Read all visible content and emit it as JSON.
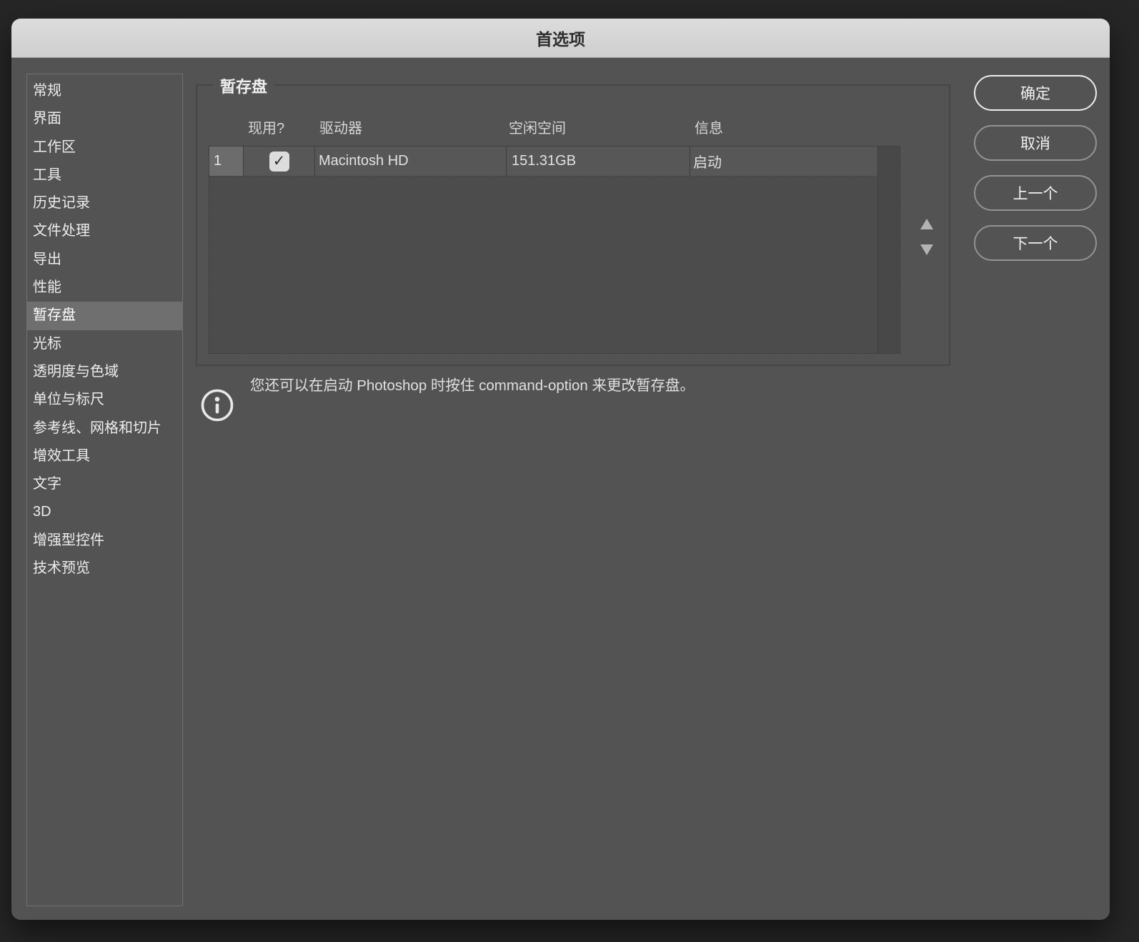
{
  "window": {
    "title": "首选项"
  },
  "sidebar": {
    "items": [
      {
        "label": "常规"
      },
      {
        "label": "界面"
      },
      {
        "label": "工作区"
      },
      {
        "label": "工具"
      },
      {
        "label": "历史记录"
      },
      {
        "label": "文件处理"
      },
      {
        "label": "导出"
      },
      {
        "label": "性能"
      },
      {
        "label": "暂存盘",
        "selected": true
      },
      {
        "label": "光标"
      },
      {
        "label": "透明度与色域"
      },
      {
        "label": "单位与标尺"
      },
      {
        "label": "参考线、网格和切片"
      },
      {
        "label": "增效工具"
      },
      {
        "label": "文字"
      },
      {
        "label": "3D"
      },
      {
        "label": "增强型控件"
      },
      {
        "label": "技术预览"
      }
    ]
  },
  "panel": {
    "group_title": "暂存盘",
    "table": {
      "columns": [
        {
          "label": "现用?"
        },
        {
          "label": "驱动器"
        },
        {
          "label": "空闲空间"
        },
        {
          "label": "信息"
        }
      ],
      "rows": [
        {
          "index": "1",
          "active": true,
          "check_glyph": "✓",
          "drive": "Macintosh HD",
          "free_space": "151.31GB",
          "info": "启动"
        }
      ]
    },
    "note": "您还可以在启动 Photoshop 时按住 command-option 来更改暂存盘。"
  },
  "actions": {
    "ok": "确定",
    "cancel": "取消",
    "previous": "上一个",
    "next": "下一个"
  },
  "colors": {
    "dialog_bg": "#535353",
    "titlebar_bg": "#d6d6d6",
    "selected_item_bg": "#6f6f6f",
    "table_bg": "#4c4c4c",
    "row_bg": "#575757",
    "primary_button_border": "#ededed"
  }
}
